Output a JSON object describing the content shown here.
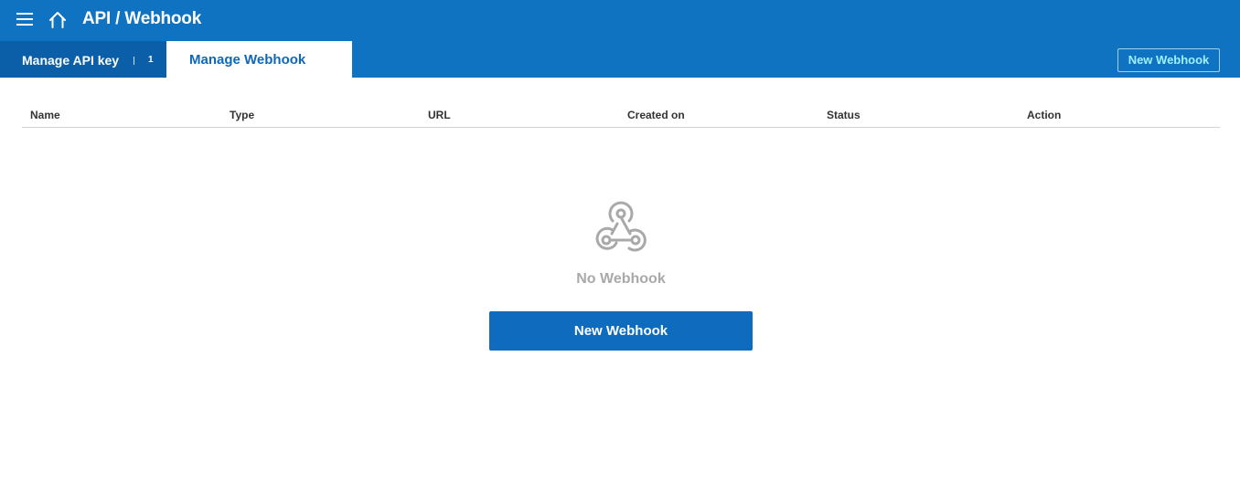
{
  "header": {
    "title": "API / Webhook",
    "menu_icon": "hamburger-menu-icon",
    "home_icon": "home-icon"
  },
  "tabs": [
    {
      "label": "Manage API key",
      "count": "1",
      "selected": false
    },
    {
      "label": "Manage Webhook",
      "selected": true
    }
  ],
  "toolbar": {
    "new_webhook_label": "New Webhook"
  },
  "table": {
    "columns": [
      "Name",
      "Type",
      "URL",
      "Created on",
      "Status",
      "Action"
    ],
    "rows": []
  },
  "empty_state": {
    "icon": "webhook-icon",
    "message": "No Webhook",
    "button_label": "New Webhook"
  },
  "colors": {
    "header_bg": "#0f73c2",
    "tab_inactive_bg": "#0b5ea8",
    "tab_active_text": "#0f67b8",
    "primary_button": "#0f6bbd",
    "muted_text": "#a9a9a9"
  }
}
